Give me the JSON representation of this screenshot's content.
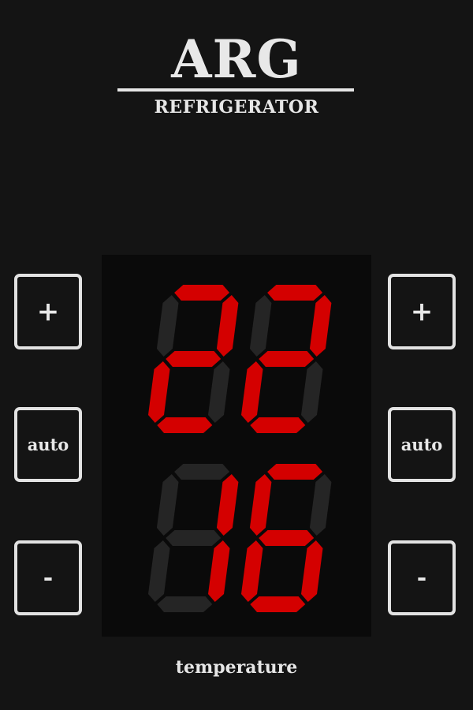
{
  "header": {
    "brand": "ARG",
    "subtitle": "REFRIGERATOR"
  },
  "controls": {
    "left": {
      "plus_label": "+",
      "auto_label": "auto",
      "minus_label": "-"
    },
    "right": {
      "plus_label": "+",
      "auto_label": "auto",
      "minus_label": "-"
    }
  },
  "display": {
    "upper_value": "22",
    "lower_value": "16",
    "lit_color": "#d40000",
    "unlit_color": "#252525",
    "background": "#0a0a0a"
  },
  "footer": {
    "caption": "temperature"
  }
}
